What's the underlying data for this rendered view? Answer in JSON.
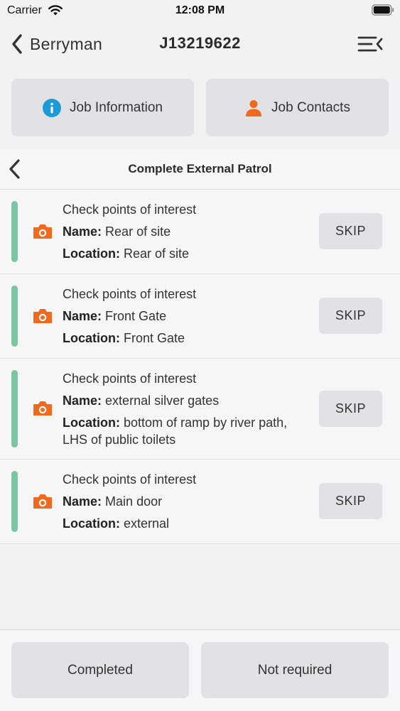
{
  "status_bar": {
    "carrier": "Carrier",
    "time": "12:08 PM"
  },
  "nav": {
    "back_label": "Berryman",
    "title": "J13219622"
  },
  "top_actions": {
    "info_label": "Job Information",
    "contacts_label": "Job Contacts"
  },
  "section": {
    "title": "Complete External Patrol"
  },
  "tasks": [
    {
      "title": "Check points of interest",
      "name_key": "Name:",
      "name": "Rear of site",
      "location_key": "Location:",
      "location": "Rear of site",
      "skip": "SKIP"
    },
    {
      "title": "Check points of interest",
      "name_key": "Name:",
      "name": "Front Gate",
      "location_key": "Location:",
      "location": "Front Gate",
      "skip": "SKIP"
    },
    {
      "title": "Check points of interest",
      "name_key": "Name:",
      "name": "external silver gates",
      "location_key": "Location:",
      "location": "bottom of ramp by river path, LHS of public toilets",
      "skip": "SKIP"
    },
    {
      "title": "Check points of interest",
      "name_key": "Name:",
      "name": "Main door",
      "location_key": "Location:",
      "location": "external",
      "skip": "SKIP"
    }
  ],
  "bottom": {
    "completed_label": "Completed",
    "not_required_label": "Not required"
  },
  "colors": {
    "accent_orange": "#f06a1d",
    "info_blue": "#1a9bd7",
    "status_green": "#7cc4a2",
    "button_gray": "#e2e2e4"
  },
  "icons": {
    "info": "info-icon",
    "contact": "person-icon",
    "camera": "camera-icon",
    "back": "chevron-left-icon",
    "menu": "menu-collapse-icon"
  }
}
